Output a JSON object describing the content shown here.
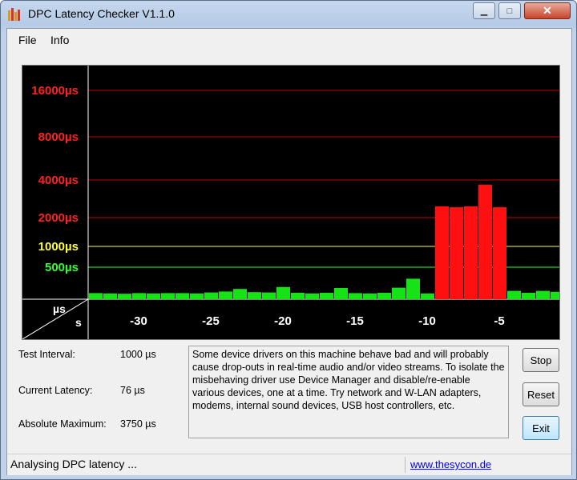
{
  "window": {
    "title": "DPC Latency Checker V1.1.0"
  },
  "menu": {
    "items": [
      "File",
      "Info"
    ]
  },
  "chart_data": {
    "type": "bar",
    "y_scale": "stepped",
    "y_ticks": [
      {
        "label": "16000µs",
        "value": 16000,
        "color": "#ff2020"
      },
      {
        "label": "8000µs",
        "value": 8000,
        "color": "#ff2020"
      },
      {
        "label": "4000µs",
        "value": 4000,
        "color": "#ff2020"
      },
      {
        "label": "2000µs",
        "value": 2000,
        "color": "#ff2020"
      },
      {
        "label": "1000µs",
        "value": 1000,
        "color": "#ffff30"
      },
      {
        "label": "500µs",
        "value": 500,
        "color": "#30ff30"
      }
    ],
    "x_ticks": [
      -30,
      -25,
      -20,
      -15,
      -10,
      -5
    ],
    "x_tick_labels": [
      "-30",
      "-25",
      "-20",
      "-15",
      "-10",
      "-5"
    ],
    "axis_unit_y": "µs",
    "axis_unit_x": "s",
    "x": [
      -33,
      -32,
      -31,
      -30,
      -29,
      -28,
      -27,
      -26,
      -25,
      -24,
      -23,
      -22,
      -21,
      -20,
      -19,
      -18,
      -17,
      -16,
      -15,
      -14,
      -13,
      -12,
      -11,
      -10,
      -9,
      -8,
      -7,
      -6,
      -5,
      -4,
      -3,
      -2,
      -1,
      0
    ],
    "values": [
      95,
      90,
      85,
      95,
      90,
      95,
      95,
      90,
      105,
      120,
      160,
      110,
      105,
      190,
      100,
      90,
      100,
      175,
      95,
      90,
      100,
      180,
      320,
      90,
      2600,
      2550,
      2600,
      3750,
      2550,
      130,
      100,
      130,
      115,
      110
    ],
    "colors": {
      "normal": "#16e316",
      "high": "#ff1010"
    }
  },
  "stats": {
    "test_interval_label": "Test Interval:",
    "test_interval_value": "1000 µs",
    "current_latency_label": "Current Latency:",
    "current_latency_value": "76 µs",
    "absolute_max_label": "Absolute Maximum:",
    "absolute_max_value": "3750 µs"
  },
  "message": "Some device drivers on this machine behave bad and will probably cause drop-outs in real-time audio and/or video streams. To isolate the misbehaving driver use Device Manager and disable/re-enable various devices, one at a time. Try network and W-LAN adapters, modems, internal sound devices, USB host controllers, etc.",
  "buttons": {
    "stop": "Stop",
    "reset": "Reset",
    "exit": "Exit"
  },
  "status": {
    "text": "Analysing DPC latency ...",
    "link": "www.thesycon.de"
  }
}
